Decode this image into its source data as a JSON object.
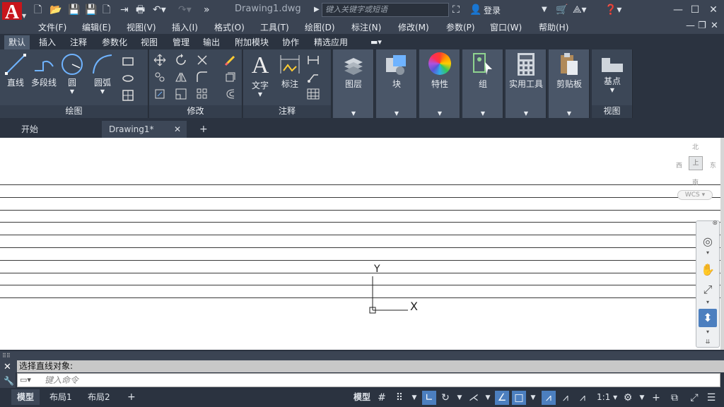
{
  "titlebar": {
    "app_letter": "A",
    "title": "Drawing1.dwg",
    "search_placeholder": "键入关键字或短语",
    "login": "登录"
  },
  "menu": [
    "文件(F)",
    "编辑(E)",
    "视图(V)",
    "插入(I)",
    "格式(O)",
    "工具(T)",
    "绘图(D)",
    "标注(N)",
    "修改(M)",
    "参数(P)",
    "窗口(W)",
    "帮助(H)"
  ],
  "ribbon_tabs": [
    "默认",
    "插入",
    "注释",
    "参数化",
    "视图",
    "管理",
    "输出",
    "附加模块",
    "协作",
    "精选应用"
  ],
  "panels": {
    "draw": {
      "title": "绘图",
      "tools": [
        "直线",
        "多段线",
        "圆",
        "圆弧"
      ]
    },
    "modify": {
      "title": "修改"
    },
    "annotation": {
      "title": "注释",
      "tools": [
        "文字",
        "标注"
      ]
    },
    "layers": {
      "label": "图层"
    },
    "block": {
      "label": "块"
    },
    "properties": {
      "label": "特性"
    },
    "group": {
      "label": "组"
    },
    "utilities": {
      "label": "实用工具"
    },
    "clipboard": {
      "label": "剪贴板"
    },
    "view": {
      "tool": "基点",
      "title": "视图"
    }
  },
  "doc_tabs": [
    "开始",
    "Drawing1*"
  ],
  "viewcube": {
    "north": "北",
    "south": "南",
    "east": "东",
    "west": "西",
    "center": "上",
    "wcs": "WCS"
  },
  "ucs": {
    "x": "X",
    "y": "Y"
  },
  "command": {
    "history": "选择直线对象:",
    "placeholder": "键入命令"
  },
  "status": {
    "layout_tabs": [
      "模型",
      "布局1",
      "布局2"
    ],
    "model_label": "模型",
    "scale": "1:1"
  },
  "canvas_lines_count": 10
}
